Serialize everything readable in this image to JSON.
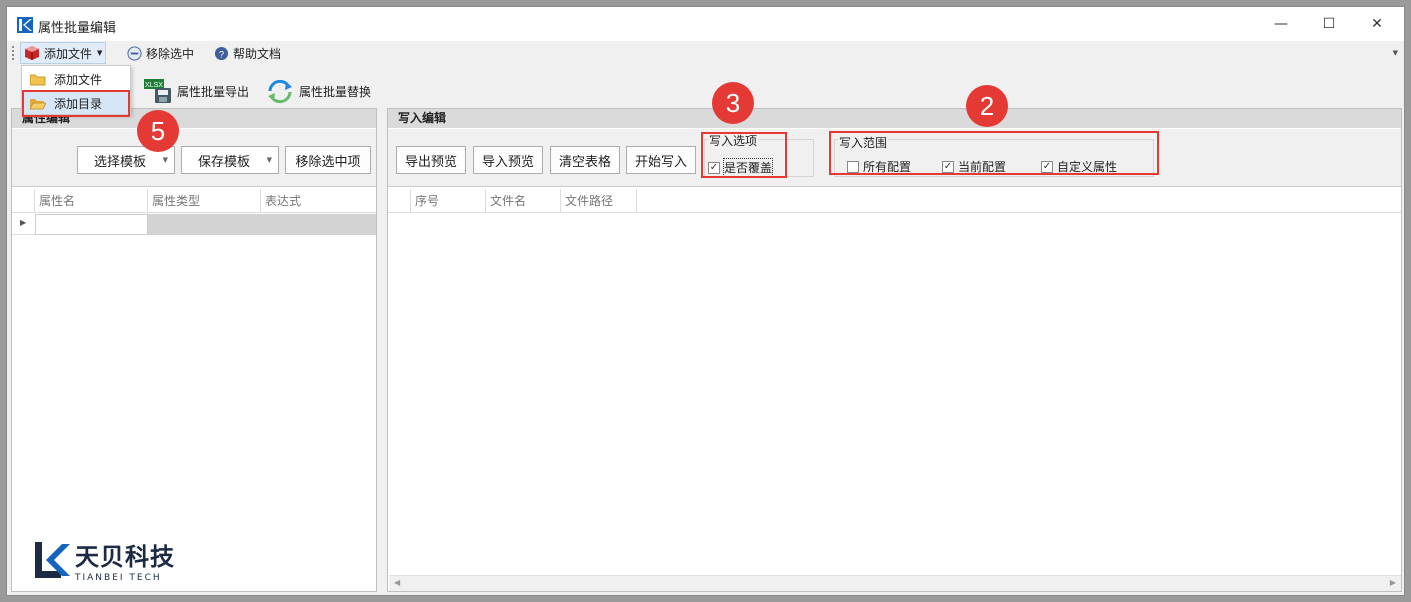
{
  "window": {
    "title": "属性批量编辑",
    "controls": {
      "minimize": "—",
      "maximize": "☐",
      "close": "✕"
    }
  },
  "toolbar": {
    "add_file_menu": "添加文件",
    "remove_selected": "移除选中",
    "help_docs": "帮助文档"
  },
  "add_file_dropdown": {
    "items": [
      "添加文件",
      "添加目录"
    ]
  },
  "toolbar2": {
    "export_label": "属性批量导出",
    "replace_label": "属性批量替换"
  },
  "left_panel": {
    "header": "属性编辑",
    "select_template": "选择模板",
    "save_template": "保存模板",
    "remove_selected_item": "移除选中项",
    "columns": [
      "属性名",
      "属性类型",
      "表达式"
    ]
  },
  "right_panel": {
    "header": "写入编辑",
    "buttons": [
      "导出预览",
      "导入预览",
      "清空表格",
      "开始写入"
    ],
    "write_options": {
      "title": "写入选项",
      "overwrite": {
        "label": "是否覆盖",
        "checked": true
      }
    },
    "write_scope": {
      "title": "写入范围",
      "options": [
        {
          "label": "所有配置",
          "checked": false
        },
        {
          "label": "当前配置",
          "checked": true
        },
        {
          "label": "自定义属性",
          "checked": true
        }
      ]
    },
    "columns": [
      "序号",
      "文件名",
      "文件路径"
    ]
  },
  "annotations": [
    "5",
    "3",
    "2"
  ],
  "logo": {
    "cn": "天贝科技",
    "en": "TIANBEI TECH"
  },
  "colors": {
    "accent": "#e53935",
    "brand": "#1c2a44",
    "panel_header": "#dadada"
  }
}
